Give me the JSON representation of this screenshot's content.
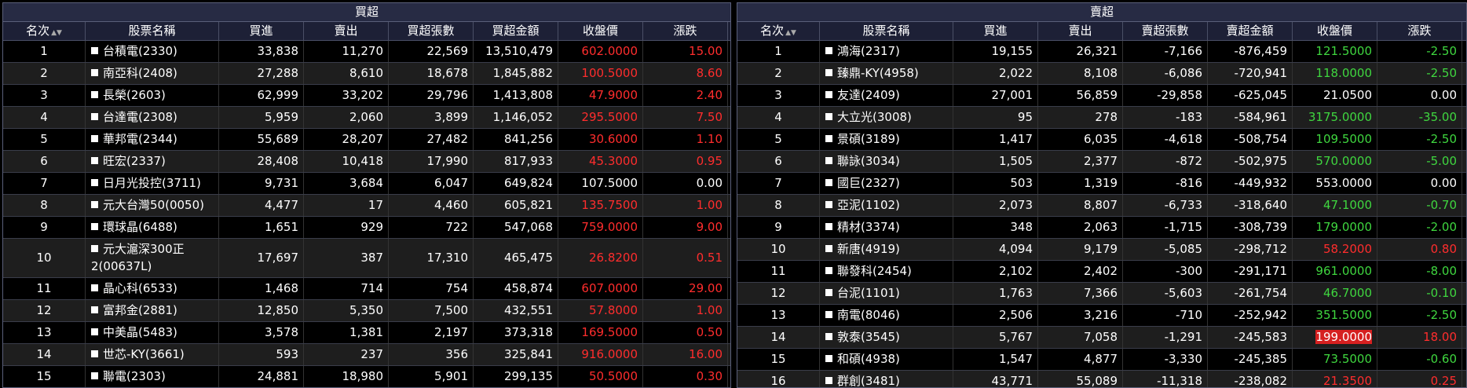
{
  "buy": {
    "title": "買超",
    "headers": {
      "rank": "名次",
      "name": "股票名稱",
      "buy": "買進",
      "sell": "賣出",
      "net": "買超張數",
      "amount": "買超金額",
      "close": "收盤價",
      "change": "漲跌"
    },
    "rows": [
      {
        "rank": "1",
        "name": "台積電(2330)",
        "buy": "33,838",
        "sell": "11,270",
        "net": "22,569",
        "amount": "13,510,479",
        "close": "602.0000",
        "change": "15.00",
        "dir": "up"
      },
      {
        "rank": "2",
        "name": "南亞科(2408)",
        "buy": "27,288",
        "sell": "8,610",
        "net": "18,678",
        "amount": "1,845,882",
        "close": "100.5000",
        "change": "8.60",
        "dir": "up"
      },
      {
        "rank": "3",
        "name": "長榮(2603)",
        "buy": "62,999",
        "sell": "33,202",
        "net": "29,796",
        "amount": "1,413,808",
        "close": "47.9000",
        "change": "2.40",
        "dir": "up"
      },
      {
        "rank": "4",
        "name": "台達電(2308)",
        "buy": "5,959",
        "sell": "2,060",
        "net": "3,899",
        "amount": "1,146,052",
        "close": "295.5000",
        "change": "7.50",
        "dir": "up"
      },
      {
        "rank": "5",
        "name": "華邦電(2344)",
        "buy": "55,689",
        "sell": "28,207",
        "net": "27,482",
        "amount": "841,256",
        "close": "30.6000",
        "change": "1.10",
        "dir": "up"
      },
      {
        "rank": "6",
        "name": "旺宏(2337)",
        "buy": "28,408",
        "sell": "10,418",
        "net": "17,990",
        "amount": "817,933",
        "close": "45.3000",
        "change": "0.95",
        "dir": "up"
      },
      {
        "rank": "7",
        "name": "日月光投控(3711)",
        "buy": "9,731",
        "sell": "3,684",
        "net": "6,047",
        "amount": "649,824",
        "close": "107.5000",
        "change": "0.00",
        "dir": "flat"
      },
      {
        "rank": "8",
        "name": "元大台灣50(0050)",
        "buy": "4,477",
        "sell": "17",
        "net": "4,460",
        "amount": "605,821",
        "close": "135.7500",
        "change": "1.00",
        "dir": "up"
      },
      {
        "rank": "9",
        "name": "環球晶(6488)",
        "buy": "1,651",
        "sell": "929",
        "net": "722",
        "amount": "547,068",
        "close": "759.0000",
        "change": "9.00",
        "dir": "up"
      },
      {
        "rank": "10",
        "name": "元大滬深300正2(00637L)",
        "buy": "17,697",
        "sell": "387",
        "net": "17,310",
        "amount": "465,475",
        "close": "26.8200",
        "change": "0.51",
        "dir": "up",
        "tall": true
      },
      {
        "rank": "11",
        "name": "晶心科(6533)",
        "buy": "1,468",
        "sell": "714",
        "net": "754",
        "amount": "458,874",
        "close": "607.0000",
        "change": "29.00",
        "dir": "up"
      },
      {
        "rank": "12",
        "name": "富邦金(2881)",
        "buy": "12,850",
        "sell": "5,350",
        "net": "7,500",
        "amount": "432,551",
        "close": "57.8000",
        "change": "1.00",
        "dir": "up"
      },
      {
        "rank": "13",
        "name": "中美晶(5483)",
        "buy": "3,578",
        "sell": "1,381",
        "net": "2,197",
        "amount": "373,318",
        "close": "169.5000",
        "change": "0.50",
        "dir": "up"
      },
      {
        "rank": "14",
        "name": "世芯-KY(3661)",
        "buy": "593",
        "sell": "237",
        "net": "356",
        "amount": "325,841",
        "close": "916.0000",
        "change": "16.00",
        "dir": "up"
      },
      {
        "rank": "15",
        "name": "聯電(2303)",
        "buy": "24,881",
        "sell": "18,980",
        "net": "5,901",
        "amount": "299,135",
        "close": "50.5000",
        "change": "0.30",
        "dir": "up"
      }
    ]
  },
  "sell": {
    "title": "賣超",
    "headers": {
      "rank": "名次",
      "name": "股票名稱",
      "buy": "買進",
      "sell": "賣出",
      "net": "賣超張數",
      "amount": "賣超金額",
      "close": "收盤價",
      "change": "漲跌"
    },
    "rows": [
      {
        "rank": "1",
        "name": "鴻海(2317)",
        "buy": "19,155",
        "sell": "26,321",
        "net": "-7,166",
        "amount": "-876,459",
        "close": "121.5000",
        "change": "-2.50",
        "dir": "down"
      },
      {
        "rank": "2",
        "name": "臻鼎-KY(4958)",
        "buy": "2,022",
        "sell": "8,108",
        "net": "-6,086",
        "amount": "-720,941",
        "close": "118.0000",
        "change": "-2.50",
        "dir": "down"
      },
      {
        "rank": "3",
        "name": "友達(2409)",
        "buy": "27,001",
        "sell": "56,859",
        "net": "-29,858",
        "amount": "-625,045",
        "close": "21.0500",
        "change": "0.00",
        "dir": "flat"
      },
      {
        "rank": "4",
        "name": "大立光(3008)",
        "buy": "95",
        "sell": "278",
        "net": "-183",
        "amount": "-584,961",
        "close": "3175.0000",
        "change": "-35.00",
        "dir": "down"
      },
      {
        "rank": "5",
        "name": "景碩(3189)",
        "buy": "1,417",
        "sell": "6,035",
        "net": "-4,618",
        "amount": "-508,754",
        "close": "109.5000",
        "change": "-2.50",
        "dir": "down"
      },
      {
        "rank": "6",
        "name": "聯詠(3034)",
        "buy": "1,505",
        "sell": "2,377",
        "net": "-872",
        "amount": "-502,975",
        "close": "570.0000",
        "change": "-5.00",
        "dir": "down"
      },
      {
        "rank": "7",
        "name": "國巨(2327)",
        "buy": "503",
        "sell": "1,319",
        "net": "-816",
        "amount": "-449,932",
        "close": "553.0000",
        "change": "0.00",
        "dir": "flat"
      },
      {
        "rank": "8",
        "name": "亞泥(1102)",
        "buy": "2,073",
        "sell": "8,807",
        "net": "-6,733",
        "amount": "-318,640",
        "close": "47.1000",
        "change": "-0.70",
        "dir": "down"
      },
      {
        "rank": "9",
        "name": "精材(3374)",
        "buy": "348",
        "sell": "2,063",
        "net": "-1,715",
        "amount": "-308,739",
        "close": "179.0000",
        "change": "-2.00",
        "dir": "down"
      },
      {
        "rank": "10",
        "name": "新唐(4919)",
        "buy": "4,094",
        "sell": "9,179",
        "net": "-5,085",
        "amount": "-298,712",
        "close": "58.2000",
        "change": "0.80",
        "dir": "up"
      },
      {
        "rank": "11",
        "name": "聯發科(2454)",
        "buy": "2,102",
        "sell": "2,402",
        "net": "-300",
        "amount": "-291,171",
        "close": "961.0000",
        "change": "-8.00",
        "dir": "down"
      },
      {
        "rank": "12",
        "name": "台泥(1101)",
        "buy": "1,763",
        "sell": "7,366",
        "net": "-5,603",
        "amount": "-261,754",
        "close": "46.7000",
        "change": "-0.10",
        "dir": "down"
      },
      {
        "rank": "13",
        "name": "南電(8046)",
        "buy": "2,506",
        "sell": "3,216",
        "net": "-710",
        "amount": "-252,942",
        "close": "351.5000",
        "change": "-2.50",
        "dir": "down"
      },
      {
        "rank": "14",
        "name": "敦泰(3545)",
        "buy": "5,767",
        "sell": "7,058",
        "net": "-1,291",
        "amount": "-245,583",
        "close": "199.0000",
        "change": "18.00",
        "dir": "limitup"
      },
      {
        "rank": "15",
        "name": "和碩(4938)",
        "buy": "1,547",
        "sell": "4,877",
        "net": "-3,330",
        "amount": "-245,385",
        "close": "73.5000",
        "change": "-0.60",
        "dir": "down"
      },
      {
        "rank": "16",
        "name": "群創(3481)",
        "buy": "43,771",
        "sell": "55,089",
        "net": "-11,318",
        "amount": "-238,082",
        "close": "21.3500",
        "change": "0.25",
        "dir": "up"
      }
    ]
  },
  "icons": {
    "sort": "sort-icon",
    "checkbox": "checkbox-icon"
  },
  "colors": {
    "up": "#ff2d2d",
    "down": "#3fd63f",
    "flat": "#ffffff",
    "limitup_bg": "#d62020",
    "header_bg": "#1d2036",
    "title_bg": "#272b44"
  }
}
